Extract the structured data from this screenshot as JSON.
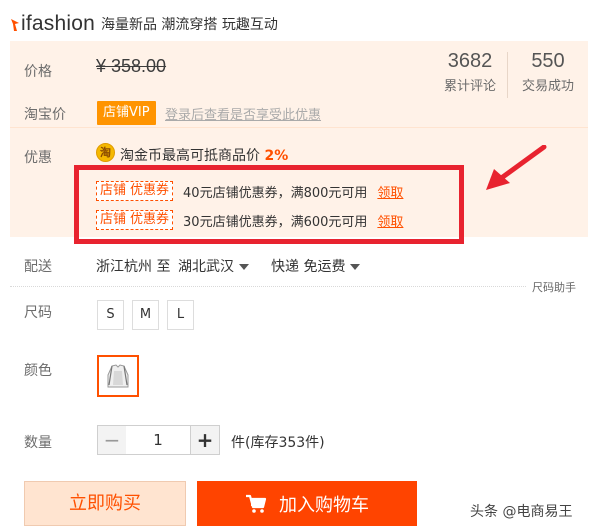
{
  "header": {
    "brand": "ifashion",
    "slogan": "海量新品 潮流穿搭 玩趣互动"
  },
  "price_panel": {
    "price_label": "价格",
    "original_price": "¥ 358.00",
    "taobao_price_label": "淘宝价",
    "vip_badge": "店铺VIP",
    "login_hint": "登录后查看是否享受此优惠",
    "stats": [
      {
        "value": "3682",
        "caption": "累计评论"
      },
      {
        "value": "550",
        "caption": "交易成功"
      }
    ],
    "promo_label": "优惠",
    "coin_icon_text": "淘",
    "coin_text": "淘金币最高可抵商品价",
    "coin_pct": "2%",
    "coupons": [
      {
        "tag_left": "店铺",
        "tag_right": "优惠券",
        "desc": "40元店铺优惠券，满800元可用",
        "action": "领取"
      },
      {
        "tag_left": "店铺",
        "tag_right": "优惠券",
        "desc": "30元店铺优惠券，满600元可用",
        "action": "领取"
      }
    ],
    "highlight_color": "#e8232f"
  },
  "delivery": {
    "label": "配送",
    "from": "浙江杭州 至",
    "to": "湖北武汉",
    "shipping": "快递 免运费"
  },
  "size": {
    "label": "尺码",
    "help": "尺码助手",
    "options": [
      "S",
      "M",
      "L"
    ]
  },
  "color": {
    "label": "颜色"
  },
  "quantity": {
    "label": "数量",
    "minus": "−",
    "value": "1",
    "plus": "+",
    "stock": "件(库存353件)"
  },
  "actions": {
    "buy_now": "立即购买",
    "add_to_cart": "加入购物车",
    "accent_color": "#ff4400"
  },
  "watermark": "头条 @电商易王"
}
